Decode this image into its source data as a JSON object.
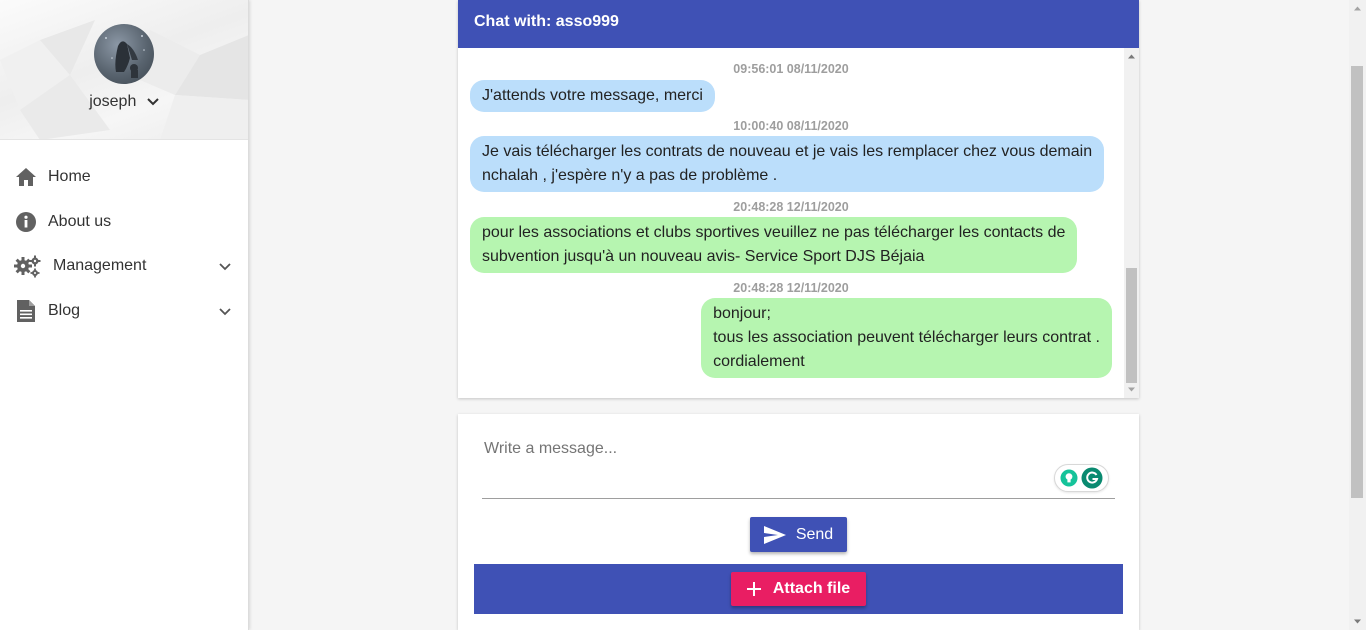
{
  "sidebar": {
    "username": "joseph",
    "nav": [
      {
        "label": "Home",
        "icon": "home-icon"
      },
      {
        "label": "About us",
        "icon": "info-icon"
      },
      {
        "label": "Management",
        "icon": "gears-icon",
        "expandable": true
      },
      {
        "label": "Blog",
        "icon": "document-icon",
        "expandable": true
      }
    ]
  },
  "chat": {
    "title": "Chat with: asso999",
    "messages": [
      {
        "timestamp": "09:56:01 08/11/2020",
        "color": "blue",
        "align": "left",
        "lines": [
          "J'attends votre message, merci"
        ]
      },
      {
        "timestamp": "10:00:40 08/11/2020",
        "color": "blue",
        "align": "left",
        "lines": [
          "Je vais télécharger les contrats de nouveau et je vais les remplacer chez vous demain",
          "nchalah , j'espère n'y a pas de problème ."
        ]
      },
      {
        "timestamp": "20:48:28 12/11/2020",
        "color": "green",
        "align": "left",
        "lines": [
          "pour les associations et clubs sportives veuillez ne pas télécharger les contacts de",
          "subvention jusqu'à un nouveau avis- Service Sport DJS Béjaia"
        ]
      },
      {
        "timestamp": "20:48:28 12/11/2020",
        "color": "green",
        "align": "right",
        "lines": [
          "bonjour;",
          "tous les association peuvent télécharger leurs contrat .",
          "cordialement"
        ]
      }
    ]
  },
  "composer": {
    "placeholder": "Write a message...",
    "send_label": "Send",
    "attach_label": "Attach file"
  },
  "colors": {
    "primary": "#3f51b5",
    "accent": "#e91e63",
    "bubble_blue": "#bbdefb",
    "bubble_green": "#b6f5b0"
  }
}
